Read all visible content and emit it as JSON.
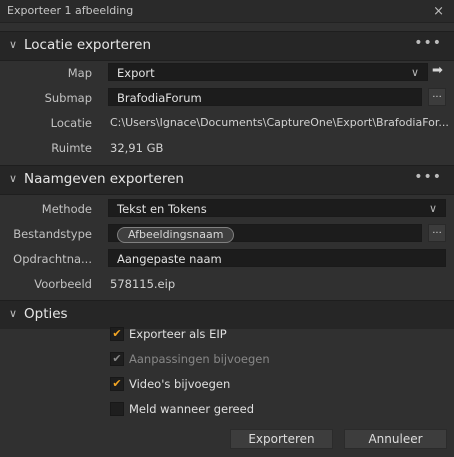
{
  "window": {
    "title": "Exporteer 1 afbeelding",
    "close_glyph": "×"
  },
  "location_section": {
    "title": "Locatie exporteren",
    "menu_glyph": "•••",
    "map_label": "Map",
    "map_value": "Export",
    "submap_label": "Submap",
    "submap_value": "BrafodiaForum",
    "locatie_label": "Locatie",
    "locatie_value": "C:\\Users\\Ignace\\Documents\\CaptureOne\\Export\\BrafodiaFor...",
    "ruimte_label": "Ruimte",
    "ruimte_value": "32,91 GB",
    "browse_label": "..."
  },
  "naming_section": {
    "title": "Naamgeven exporteren",
    "menu_glyph": "•••",
    "methode_label": "Methode",
    "methode_value": "Tekst en Tokens",
    "bestandstype_label": "Bestandstype",
    "bestandstype_token": "Afbeeldingsnaam",
    "opdrachtnaam_label": "Opdrachtna...",
    "opdrachtnaam_value": "Aangepaste naam",
    "voorbeeld_label": "Voorbeeld",
    "voorbeeld_value": "578115.eip",
    "browse_label": "..."
  },
  "options_section": {
    "title": "Opties",
    "options": [
      {
        "label": "Exporteer als EIP",
        "checked": true,
        "disabled": false
      },
      {
        "label": "Aanpassingen bijvoegen",
        "checked": true,
        "disabled": true
      },
      {
        "label": "Video's bijvoegen",
        "checked": true,
        "disabled": false
      },
      {
        "label": "Meld wanneer gereed",
        "checked": false,
        "disabled": false
      }
    ]
  },
  "footer": {
    "export_button": "Exporteren",
    "cancel_button": "Annuleer"
  },
  "icons": {
    "chevron": "chevron-down-icon",
    "arrow": "arrow-right-icon",
    "check": "checkmark-icon"
  },
  "colors": {
    "accent_check": "#f5a623",
    "background": "#303030",
    "header": "#262626"
  }
}
